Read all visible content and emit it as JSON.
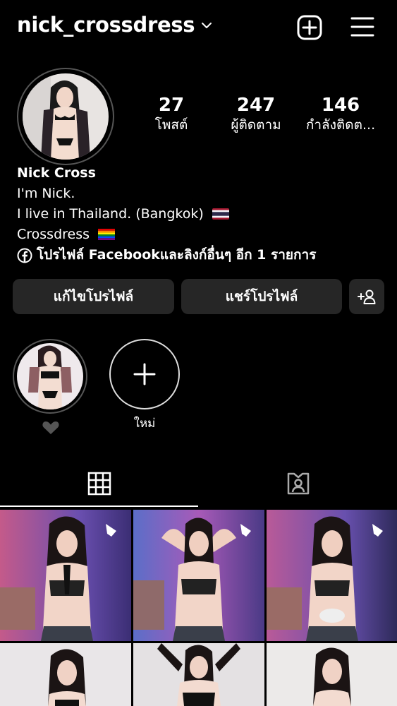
{
  "header": {
    "username": "nick_crossdress",
    "icons": [
      "chevron-down-icon",
      "new-post-icon",
      "hamburger-menu-icon"
    ]
  },
  "stats": [
    {
      "value": "27",
      "label": "โพสต์"
    },
    {
      "value": "247",
      "label": "ผู้ติดตาม"
    },
    {
      "value": "146",
      "label": "กำลังติดต..."
    }
  ],
  "bio": {
    "name": "Nick Cross",
    "line1": "I'm Nick.",
    "line2": "I live in Thailand. (Bangkok)",
    "line3": "Crossdress",
    "links": "โปรไฟล์ Facebookและลิงก์อื่นๆ อีก 1 รายการ"
  },
  "buttons": {
    "edit": "แก้ไขโปรไฟล์",
    "share": "แชร์โปรไฟล์"
  },
  "highlights": {
    "new_label": "ใหม่"
  },
  "colors": {
    "background": "#000000",
    "button_bg": "#262626"
  }
}
